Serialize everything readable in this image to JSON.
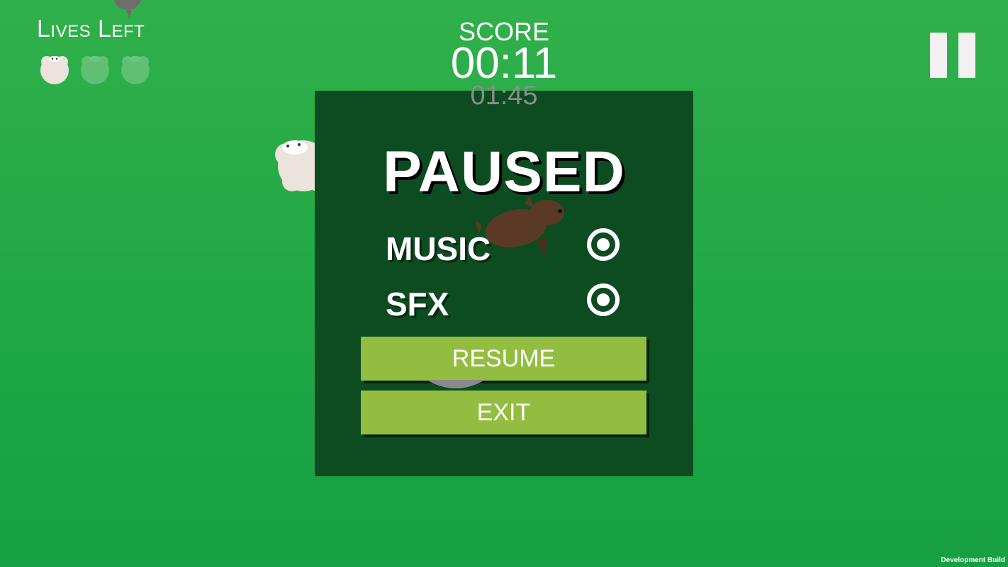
{
  "hud": {
    "lives_title": "Lives Left",
    "lives": {
      "remaining": 1,
      "total": 3
    },
    "score_label": "SCORE",
    "score_time": "00:11",
    "best_time": "01:45"
  },
  "pause_menu": {
    "title": "PAUSED",
    "music_label": "MUSIC",
    "music_on": true,
    "sfx_label": "SFX",
    "sfx_on": true,
    "resume_label": "RESUME",
    "exit_label": "EXIT"
  },
  "footer": {
    "dev_build": "Development Build"
  },
  "colors": {
    "background": "#2aad4a",
    "panel": "#0c4c20",
    "button": "#93bd40",
    "sheep": "#ece4dc",
    "wolf": "#5a3a26"
  },
  "icons": {
    "pause": "pause-icon",
    "toggle": "radio-on-icon",
    "sheep": "sheep-icon",
    "wolf": "wolf-icon"
  }
}
